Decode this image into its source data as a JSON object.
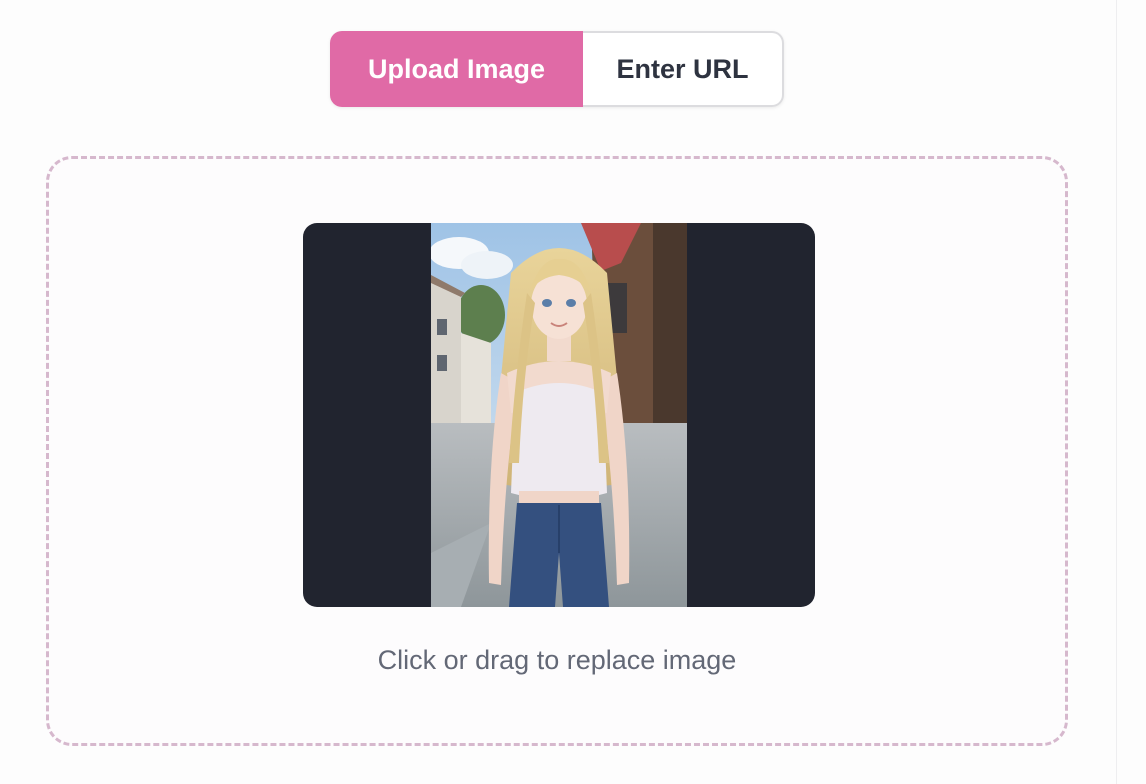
{
  "mode_toggle": {
    "upload_label": "Upload Image",
    "url_label": "Enter URL",
    "active": "upload",
    "accent_color": "#e06aa6"
  },
  "dropzone": {
    "hint": "Click or drag to replace image",
    "preview_icon": "uploaded-image-preview"
  }
}
